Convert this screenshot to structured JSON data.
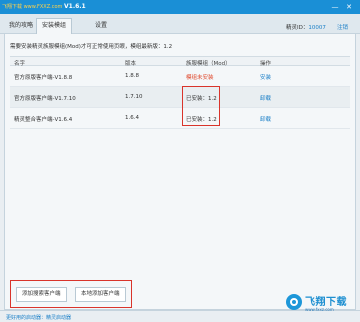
{
  "titlebar": {
    "watermark": "飞翔下载 www.FXXZ.com",
    "version": "V1.6.1",
    "min_label": "—",
    "close_label": "✕"
  },
  "tabs": [
    {
      "label": "我的攻略",
      "active": false
    },
    {
      "label": "安装模组",
      "active": true
    },
    {
      "label": "设置",
      "active": false
    }
  ],
  "user": {
    "id_label": "精灵ID：",
    "id_value": "10007",
    "logout": "注销"
  },
  "summary": "需要安装精灵族服模组(Mod)才可正常使用页眼，模组最新版：1.2",
  "table": {
    "headers": [
      "名字",
      "版本",
      "族服模组（Mod）",
      "操作"
    ],
    "rows": [
      {
        "name": "官方原版客户端-V1.8.8",
        "version": "1.8.8",
        "mod": "模组未安装",
        "op": "安装",
        "warn": true
      },
      {
        "name": "官方原版客户端-V1.7.10",
        "version": "1.7.10",
        "mod": "已安装：1.2",
        "op": "卸载",
        "warn": false
      },
      {
        "name": "精灵整合客户端-V1.6.4",
        "version": "1.6.4",
        "mod": "已安装：1.2",
        "op": "卸载",
        "warn": false
      }
    ]
  },
  "buttons": {
    "add_client": "添加搜索客户端",
    "add_local": "本地添加客户端"
  },
  "statusbar": "更好用的启动器：精灵启动器",
  "logo": {
    "text": "飞翔下载",
    "url": "www.fxxz.com"
  },
  "colors": {
    "accent": "#1a8fd6",
    "link": "#1a7fc7",
    "warn": "#e04a2e",
    "highlight": "#d9342b"
  }
}
